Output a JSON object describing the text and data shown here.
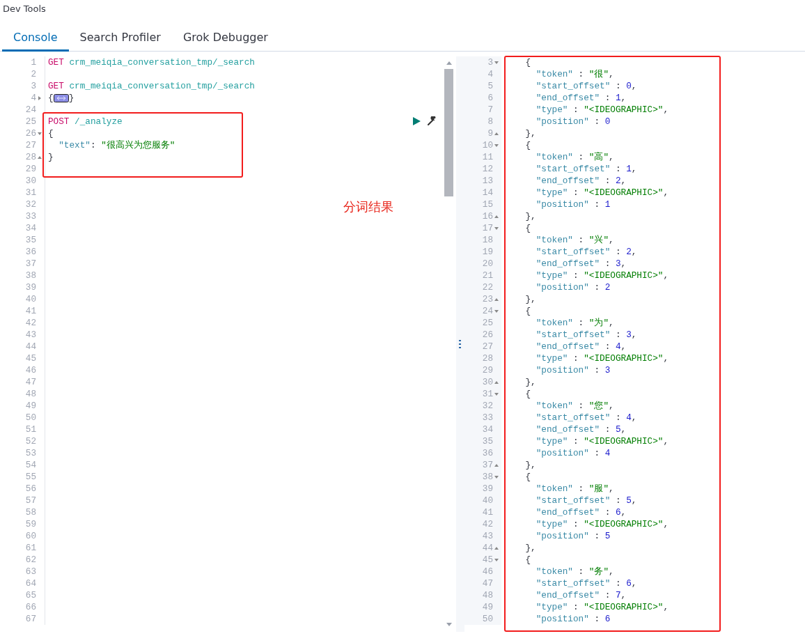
{
  "title": "Dev Tools",
  "tabs": [
    {
      "label": "Console",
      "selected": true
    },
    {
      "label": "Search Profiler",
      "selected": false
    },
    {
      "label": "Grok Debugger",
      "selected": false
    }
  ],
  "editor": {
    "lines": [
      {
        "number": "1",
        "tokens": [
          {
            "kind": "method",
            "text": "GET"
          },
          {
            "kind": "url",
            "text": " crm_meiqia_conversation_tmp/_search"
          }
        ]
      },
      {
        "number": "2"
      },
      {
        "number": "3",
        "tokens": [
          {
            "kind": "method",
            "text": "GET"
          },
          {
            "kind": "url",
            "text": " crm_meiqia_conversation_tmp/_search"
          }
        ]
      },
      {
        "number": "4",
        "expanded": false,
        "tokens": [
          {
            "kind": "brace",
            "text": "{"
          },
          {
            "kind": "widget"
          },
          {
            "kind": "brace",
            "text": "}"
          }
        ]
      },
      {
        "number": "24"
      },
      {
        "number": "25",
        "tokens": [
          {
            "kind": "method",
            "text": "POST"
          },
          {
            "kind": "url",
            "text": " /_analyze"
          }
        ]
      },
      {
        "number": "26",
        "expanded": true,
        "tokens": [
          {
            "kind": "brace",
            "text": "{"
          }
        ]
      },
      {
        "number": "27",
        "tokens": [
          {
            "kind": "key",
            "text": "  \"text\""
          },
          {
            "kind": "punct",
            "text": ": "
          },
          {
            "kind": "string",
            "text": "\"很高兴为您服务\""
          }
        ]
      },
      {
        "number": "28",
        "fold_end": true,
        "tokens": [
          {
            "kind": "brace",
            "text": "}"
          }
        ]
      },
      {
        "number": "29"
      },
      {
        "number": "30"
      },
      {
        "number": "31"
      },
      {
        "number": "32"
      },
      {
        "number": "33"
      },
      {
        "number": "34"
      },
      {
        "number": "35"
      },
      {
        "number": "36"
      },
      {
        "number": "37"
      },
      {
        "number": "38"
      },
      {
        "number": "39"
      },
      {
        "number": "40"
      },
      {
        "number": "41"
      },
      {
        "number": "42"
      },
      {
        "number": "43"
      },
      {
        "number": "44"
      },
      {
        "number": "45"
      },
      {
        "number": "46"
      },
      {
        "number": "47"
      },
      {
        "number": "48"
      },
      {
        "number": "49"
      },
      {
        "number": "50"
      },
      {
        "number": "51"
      },
      {
        "number": "52"
      },
      {
        "number": "53"
      },
      {
        "number": "54"
      },
      {
        "number": "55"
      },
      {
        "number": "56"
      },
      {
        "number": "57"
      },
      {
        "number": "58"
      },
      {
        "number": "59"
      },
      {
        "number": "60"
      },
      {
        "number": "61"
      },
      {
        "number": "62"
      },
      {
        "number": "63"
      },
      {
        "number": "64"
      },
      {
        "number": "65"
      },
      {
        "number": "66"
      },
      {
        "number": "67"
      }
    ]
  },
  "annotation": {
    "label": "分词结果"
  },
  "output": {
    "lines": [
      {
        "number": "3",
        "expanded": true,
        "tokens": [
          {
            "kind": "brace",
            "text": "    {"
          }
        ]
      },
      {
        "number": "4",
        "tokens": [
          {
            "kind": "key",
            "text": "      \"token\""
          },
          {
            "kind": "punct",
            "text": " : "
          },
          {
            "kind": "string",
            "text": "\"很\""
          },
          {
            "kind": "punct",
            "text": ","
          }
        ]
      },
      {
        "number": "5",
        "tokens": [
          {
            "kind": "key",
            "text": "      \"start_offset\""
          },
          {
            "kind": "punct",
            "text": " : "
          },
          {
            "kind": "number",
            "text": "0"
          },
          {
            "kind": "punct",
            "text": ","
          }
        ]
      },
      {
        "number": "6",
        "tokens": [
          {
            "kind": "key",
            "text": "      \"end_offset\""
          },
          {
            "kind": "punct",
            "text": " : "
          },
          {
            "kind": "number",
            "text": "1"
          },
          {
            "kind": "punct",
            "text": ","
          }
        ]
      },
      {
        "number": "7",
        "tokens": [
          {
            "kind": "key",
            "text": "      \"type\""
          },
          {
            "kind": "punct",
            "text": " : "
          },
          {
            "kind": "string",
            "text": "\"<IDEOGRAPHIC>\""
          },
          {
            "kind": "punct",
            "text": ","
          }
        ]
      },
      {
        "number": "8",
        "tokens": [
          {
            "kind": "key",
            "text": "      \"position\""
          },
          {
            "kind": "punct",
            "text": " : "
          },
          {
            "kind": "number",
            "text": "0"
          }
        ]
      },
      {
        "number": "9",
        "fold_end": true,
        "tokens": [
          {
            "kind": "brace",
            "text": "    },"
          }
        ]
      },
      {
        "number": "10",
        "expanded": true,
        "tokens": [
          {
            "kind": "brace",
            "text": "    {"
          }
        ]
      },
      {
        "number": "11",
        "tokens": [
          {
            "kind": "key",
            "text": "      \"token\""
          },
          {
            "kind": "punct",
            "text": " : "
          },
          {
            "kind": "string",
            "text": "\"高\""
          },
          {
            "kind": "punct",
            "text": ","
          }
        ]
      },
      {
        "number": "12",
        "tokens": [
          {
            "kind": "key",
            "text": "      \"start_offset\""
          },
          {
            "kind": "punct",
            "text": " : "
          },
          {
            "kind": "number",
            "text": "1"
          },
          {
            "kind": "punct",
            "text": ","
          }
        ]
      },
      {
        "number": "13",
        "tokens": [
          {
            "kind": "key",
            "text": "      \"end_offset\""
          },
          {
            "kind": "punct",
            "text": " : "
          },
          {
            "kind": "number",
            "text": "2"
          },
          {
            "kind": "punct",
            "text": ","
          }
        ]
      },
      {
        "number": "14",
        "tokens": [
          {
            "kind": "key",
            "text": "      \"type\""
          },
          {
            "kind": "punct",
            "text": " : "
          },
          {
            "kind": "string",
            "text": "\"<IDEOGRAPHIC>\""
          },
          {
            "kind": "punct",
            "text": ","
          }
        ]
      },
      {
        "number": "15",
        "tokens": [
          {
            "kind": "key",
            "text": "      \"position\""
          },
          {
            "kind": "punct",
            "text": " : "
          },
          {
            "kind": "number",
            "text": "1"
          }
        ]
      },
      {
        "number": "16",
        "fold_end": true,
        "tokens": [
          {
            "kind": "brace",
            "text": "    },"
          }
        ]
      },
      {
        "number": "17",
        "expanded": true,
        "tokens": [
          {
            "kind": "brace",
            "text": "    {"
          }
        ]
      },
      {
        "number": "18",
        "tokens": [
          {
            "kind": "key",
            "text": "      \"token\""
          },
          {
            "kind": "punct",
            "text": " : "
          },
          {
            "kind": "string",
            "text": "\"兴\""
          },
          {
            "kind": "punct",
            "text": ","
          }
        ]
      },
      {
        "number": "19",
        "tokens": [
          {
            "kind": "key",
            "text": "      \"start_offset\""
          },
          {
            "kind": "punct",
            "text": " : "
          },
          {
            "kind": "number",
            "text": "2"
          },
          {
            "kind": "punct",
            "text": ","
          }
        ]
      },
      {
        "number": "20",
        "tokens": [
          {
            "kind": "key",
            "text": "      \"end_offset\""
          },
          {
            "kind": "punct",
            "text": " : "
          },
          {
            "kind": "number",
            "text": "3"
          },
          {
            "kind": "punct",
            "text": ","
          }
        ]
      },
      {
        "number": "21",
        "tokens": [
          {
            "kind": "key",
            "text": "      \"type\""
          },
          {
            "kind": "punct",
            "text": " : "
          },
          {
            "kind": "string",
            "text": "\"<IDEOGRAPHIC>\""
          },
          {
            "kind": "punct",
            "text": ","
          }
        ]
      },
      {
        "number": "22",
        "tokens": [
          {
            "kind": "key",
            "text": "      \"position\""
          },
          {
            "kind": "punct",
            "text": " : "
          },
          {
            "kind": "number",
            "text": "2"
          }
        ]
      },
      {
        "number": "23",
        "fold_end": true,
        "tokens": [
          {
            "kind": "brace",
            "text": "    },"
          }
        ]
      },
      {
        "number": "24",
        "expanded": true,
        "tokens": [
          {
            "kind": "brace",
            "text": "    {"
          }
        ]
      },
      {
        "number": "25",
        "tokens": [
          {
            "kind": "key",
            "text": "      \"token\""
          },
          {
            "kind": "punct",
            "text": " : "
          },
          {
            "kind": "string",
            "text": "\"为\""
          },
          {
            "kind": "punct",
            "text": ","
          }
        ]
      },
      {
        "number": "26",
        "tokens": [
          {
            "kind": "key",
            "text": "      \"start_offset\""
          },
          {
            "kind": "punct",
            "text": " : "
          },
          {
            "kind": "number",
            "text": "3"
          },
          {
            "kind": "punct",
            "text": ","
          }
        ]
      },
      {
        "number": "27",
        "tokens": [
          {
            "kind": "key",
            "text": "      \"end_offset\""
          },
          {
            "kind": "punct",
            "text": " : "
          },
          {
            "kind": "number",
            "text": "4"
          },
          {
            "kind": "punct",
            "text": ","
          }
        ]
      },
      {
        "number": "28",
        "tokens": [
          {
            "kind": "key",
            "text": "      \"type\""
          },
          {
            "kind": "punct",
            "text": " : "
          },
          {
            "kind": "string",
            "text": "\"<IDEOGRAPHIC>\""
          },
          {
            "kind": "punct",
            "text": ","
          }
        ]
      },
      {
        "number": "29",
        "tokens": [
          {
            "kind": "key",
            "text": "      \"position\""
          },
          {
            "kind": "punct",
            "text": " : "
          },
          {
            "kind": "number",
            "text": "3"
          }
        ]
      },
      {
        "number": "30",
        "fold_end": true,
        "tokens": [
          {
            "kind": "brace",
            "text": "    },"
          }
        ]
      },
      {
        "number": "31",
        "expanded": true,
        "tokens": [
          {
            "kind": "brace",
            "text": "    {"
          }
        ]
      },
      {
        "number": "32",
        "tokens": [
          {
            "kind": "key",
            "text": "      \"token\""
          },
          {
            "kind": "punct",
            "text": " : "
          },
          {
            "kind": "string",
            "text": "\"您\""
          },
          {
            "kind": "punct",
            "text": ","
          }
        ]
      },
      {
        "number": "33",
        "tokens": [
          {
            "kind": "key",
            "text": "      \"start_offset\""
          },
          {
            "kind": "punct",
            "text": " : "
          },
          {
            "kind": "number",
            "text": "4"
          },
          {
            "kind": "punct",
            "text": ","
          }
        ]
      },
      {
        "number": "34",
        "tokens": [
          {
            "kind": "key",
            "text": "      \"end_offset\""
          },
          {
            "kind": "punct",
            "text": " : "
          },
          {
            "kind": "number",
            "text": "5"
          },
          {
            "kind": "punct",
            "text": ","
          }
        ]
      },
      {
        "number": "35",
        "tokens": [
          {
            "kind": "key",
            "text": "      \"type\""
          },
          {
            "kind": "punct",
            "text": " : "
          },
          {
            "kind": "string",
            "text": "\"<IDEOGRAPHIC>\""
          },
          {
            "kind": "punct",
            "text": ","
          }
        ]
      },
      {
        "number": "36",
        "tokens": [
          {
            "kind": "key",
            "text": "      \"position\""
          },
          {
            "kind": "punct",
            "text": " : "
          },
          {
            "kind": "number",
            "text": "4"
          }
        ]
      },
      {
        "number": "37",
        "fold_end": true,
        "tokens": [
          {
            "kind": "brace",
            "text": "    },"
          }
        ]
      },
      {
        "number": "38",
        "expanded": true,
        "tokens": [
          {
            "kind": "brace",
            "text": "    {"
          }
        ]
      },
      {
        "number": "39",
        "tokens": [
          {
            "kind": "key",
            "text": "      \"token\""
          },
          {
            "kind": "punct",
            "text": " : "
          },
          {
            "kind": "string",
            "text": "\"服\""
          },
          {
            "kind": "punct",
            "text": ","
          }
        ]
      },
      {
        "number": "40",
        "tokens": [
          {
            "kind": "key",
            "text": "      \"start_offset\""
          },
          {
            "kind": "punct",
            "text": " : "
          },
          {
            "kind": "number",
            "text": "5"
          },
          {
            "kind": "punct",
            "text": ","
          }
        ]
      },
      {
        "number": "41",
        "tokens": [
          {
            "kind": "key",
            "text": "      \"end_offset\""
          },
          {
            "kind": "punct",
            "text": " : "
          },
          {
            "kind": "number",
            "text": "6"
          },
          {
            "kind": "punct",
            "text": ","
          }
        ]
      },
      {
        "number": "42",
        "tokens": [
          {
            "kind": "key",
            "text": "      \"type\""
          },
          {
            "kind": "punct",
            "text": " : "
          },
          {
            "kind": "string",
            "text": "\"<IDEOGRAPHIC>\""
          },
          {
            "kind": "punct",
            "text": ","
          }
        ]
      },
      {
        "number": "43",
        "tokens": [
          {
            "kind": "key",
            "text": "      \"position\""
          },
          {
            "kind": "punct",
            "text": " : "
          },
          {
            "kind": "number",
            "text": "5"
          }
        ]
      },
      {
        "number": "44",
        "fold_end": true,
        "tokens": [
          {
            "kind": "brace",
            "text": "    },"
          }
        ]
      },
      {
        "number": "45",
        "expanded": true,
        "tokens": [
          {
            "kind": "brace",
            "text": "    {"
          }
        ]
      },
      {
        "number": "46",
        "tokens": [
          {
            "kind": "key",
            "text": "      \"token\""
          },
          {
            "kind": "punct",
            "text": " : "
          },
          {
            "kind": "string",
            "text": "\"务\""
          },
          {
            "kind": "punct",
            "text": ","
          }
        ]
      },
      {
        "number": "47",
        "tokens": [
          {
            "kind": "key",
            "text": "      \"start_offset\""
          },
          {
            "kind": "punct",
            "text": " : "
          },
          {
            "kind": "number",
            "text": "6"
          },
          {
            "kind": "punct",
            "text": ","
          }
        ]
      },
      {
        "number": "48",
        "tokens": [
          {
            "kind": "key",
            "text": "      \"end_offset\""
          },
          {
            "kind": "punct",
            "text": " : "
          },
          {
            "kind": "number",
            "text": "7"
          },
          {
            "kind": "punct",
            "text": ","
          }
        ]
      },
      {
        "number": "49",
        "tokens": [
          {
            "kind": "key",
            "text": "      \"type\""
          },
          {
            "kind": "punct",
            "text": " : "
          },
          {
            "kind": "string",
            "text": "\"<IDEOGRAPHIC>\""
          },
          {
            "kind": "punct",
            "text": ","
          }
        ]
      },
      {
        "number": "50",
        "tokens": [
          {
            "kind": "key",
            "text": "      \"position\""
          },
          {
            "kind": "punct",
            "text": " : "
          },
          {
            "kind": "number",
            "text": "6"
          }
        ]
      }
    ]
  }
}
